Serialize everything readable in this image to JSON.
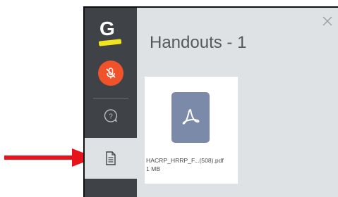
{
  "app": {
    "logo_letter": "G"
  },
  "panel": {
    "title": "Handouts - 1"
  },
  "files": [
    {
      "name": "HACRP_HRRP_F...(508).pdf",
      "size": "1 MB"
    }
  ],
  "sidebar": {
    "items": [
      {
        "icon": "microphone-muted-icon",
        "active": false
      },
      {
        "icon": "question-chat-icon",
        "active": false
      },
      {
        "icon": "document-icon",
        "active": true
      }
    ]
  },
  "colors": {
    "sidebar_bg": "#3f4246",
    "panel_bg": "#dfe2e4",
    "mic_button": "#f0532a",
    "logo_underline": "#f2e51d",
    "pdf_icon": "#7b8aa8",
    "annotation_arrow": "#e8141b"
  }
}
